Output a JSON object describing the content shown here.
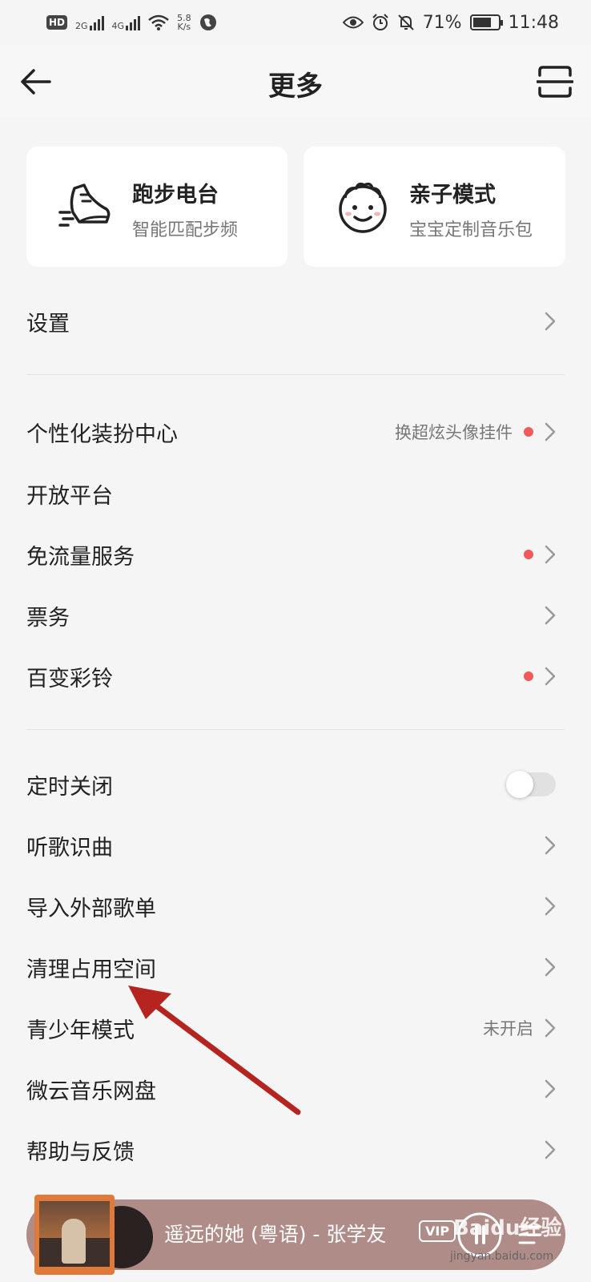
{
  "status_bar": {
    "hd_badge": "HD",
    "net_2g": "2G",
    "net_4g": "4G",
    "speed": "5.8",
    "speed_unit": "K/s",
    "battery": "71%",
    "time": "11:48"
  },
  "header": {
    "title": "更多"
  },
  "cards": {
    "running": {
      "title": "跑步电台",
      "subtitle": "智能匹配步频"
    },
    "kids": {
      "title": "亲子模式",
      "subtitle": "宝宝定制音乐包"
    }
  },
  "settings": {
    "label": "设置"
  },
  "group1": {
    "personalize": {
      "label": "个性化装扮中心",
      "extra": "换超炫头像挂件"
    },
    "open_platform": {
      "label": "开放平台"
    },
    "free_data": {
      "label": "免流量服务"
    },
    "tickets": {
      "label": "票务"
    },
    "ringtone": {
      "label": "百变彩铃"
    }
  },
  "group2": {
    "sleep_timer": {
      "label": "定时关闭",
      "enabled": false
    },
    "song_recognition": {
      "label": "听歌识曲"
    },
    "import_playlist": {
      "label": "导入外部歌单"
    },
    "clear_storage": {
      "label": "清理占用空间"
    },
    "teen_mode": {
      "label": "青少年模式",
      "extra": "未开启"
    },
    "cloud_drive": {
      "label": "微云音乐网盘"
    },
    "help": {
      "label": "帮助与反馈"
    }
  },
  "player": {
    "song": "遥远的她 (粤语) - 张学友",
    "vip_badge": "VIP"
  },
  "watermark": {
    "text": "Baidu经验",
    "url": "jingyan.baidu.com"
  },
  "colors": {
    "background": "#f5f5f5",
    "card": "#ffffff",
    "red_dot": "#f25a5a",
    "annotation_arrow": "#b5241e",
    "player_bg": "#b08c88"
  }
}
